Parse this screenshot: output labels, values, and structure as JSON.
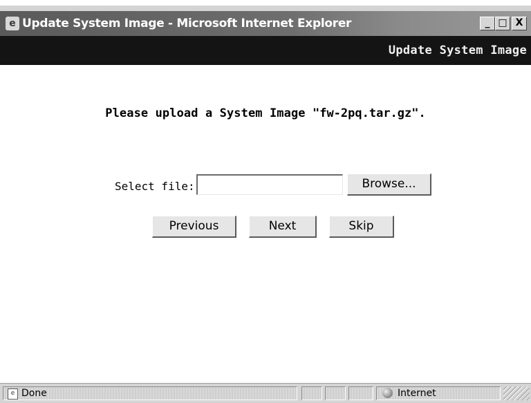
{
  "window": {
    "title": "Update System Image - Microsoft Internet Explorer",
    "controls": {
      "minimize": "_",
      "maximize": "□",
      "close": "X"
    }
  },
  "header": {
    "title": "Update System Image"
  },
  "main": {
    "prompt_prefix": "Please upload a System Image ",
    "prompt_filename": "\"fw-2pq.tar.gz\".",
    "select_label": "Select file:",
    "file_value": "",
    "browse_label": "Browse...",
    "buttons": {
      "previous": "Previous",
      "next": "Next",
      "skip": "Skip"
    }
  },
  "statusbar": {
    "status": "Done",
    "zone": "Internet"
  },
  "icons": {
    "app": "ie-page-icon",
    "status_page": "page-icon",
    "zone": "globe-icon"
  }
}
